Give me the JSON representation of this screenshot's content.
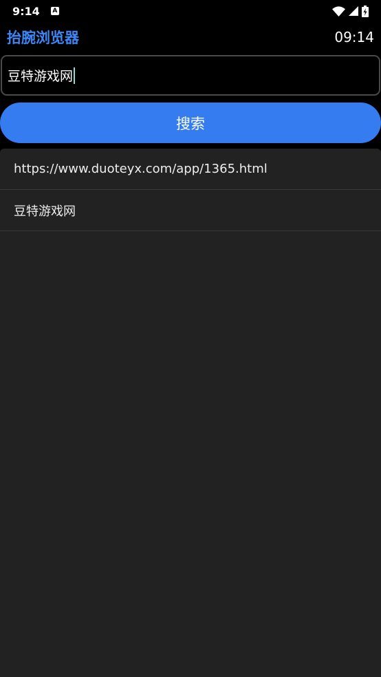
{
  "status_bar": {
    "time": "9:14",
    "notification_icon": "a-icon",
    "wifi_icon": "wifi-icon",
    "signal_icon": "signal-icon",
    "battery_icon": "battery-charging-icon"
  },
  "header": {
    "title": "抬腕浏览器",
    "clock": "09:14",
    "title_color": "#3d86f5"
  },
  "search": {
    "value": "豆特游戏网",
    "button_label": "搜索",
    "button_color": "#357cf0"
  },
  "suggestions": [
    {
      "label": "https://www.duoteyx.com/app/1365.html"
    },
    {
      "label": "豆特游戏网"
    }
  ]
}
